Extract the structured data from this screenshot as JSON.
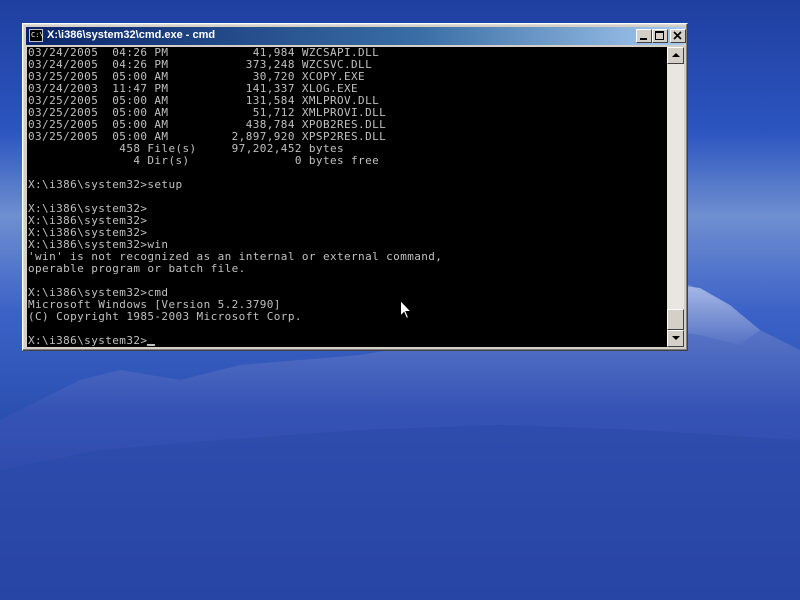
{
  "window": {
    "title": "X:\\i386\\system32\\cmd.exe - cmd",
    "icon_label": "C:\\"
  },
  "console": {
    "lines": [
      "03/24/2005  04:26 PM            41,984 WZCSAPI.DLL",
      "03/24/2005  04:26 PM           373,248 WZCSVC.DLL",
      "03/25/2005  05:00 AM            30,720 XCOPY.EXE",
      "03/24/2003  11:47 PM           141,337 XLOG.EXE",
      "03/25/2005  05:00 AM           131,584 XMLPROV.DLL",
      "03/25/2005  05:00 AM            51,712 XMLPROVI.DLL",
      "03/25/2005  05:00 AM           438,784 XPOB2RES.DLL",
      "03/25/2005  05:00 AM         2,897,920 XPSP2RES.DLL",
      "             458 File(s)     97,202,452 bytes",
      "               4 Dir(s)               0 bytes free",
      "",
      "X:\\i386\\system32>setup",
      "",
      "X:\\i386\\system32>",
      "X:\\i386\\system32>",
      "X:\\i386\\system32>",
      "X:\\i386\\system32>win",
      "'win' is not recognized as an internal or external command,",
      "operable program or batch file.",
      "",
      "X:\\i386\\system32>cmd",
      "Microsoft Windows [Version 5.2.3790]",
      "(C) Copyright 1985-2003 Microsoft Corp.",
      "",
      "X:\\i386\\system32>"
    ]
  },
  "icons": {
    "minimize": "minimize-icon",
    "maximize": "maximize-icon",
    "close": "close-icon",
    "scroll_up": "arrow-up-icon",
    "scroll_down": "arrow-down-icon",
    "pointer": "mouse-pointer-icon"
  },
  "scroll_position": 1.0,
  "colors": {
    "title_bar": "#0a246a",
    "console_bg": "#000000",
    "console_text": "#c0c0c0"
  }
}
